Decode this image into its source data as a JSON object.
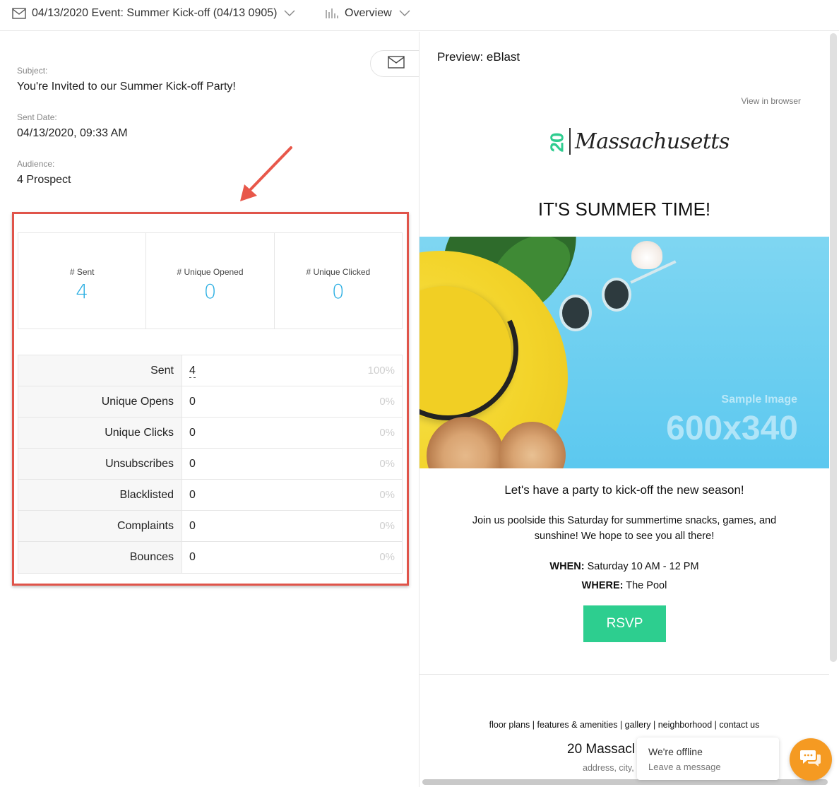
{
  "topbar": {
    "event_label": "04/13/2020 Event: Summer Kick-off (04/13 0905)",
    "view_label": "Overview"
  },
  "meta": {
    "subject_label": "Subject:",
    "subject_value": "You're Invited to our Summer Kick-off Party!",
    "sent_date_label": "Sent Date:",
    "sent_date_value": "04/13/2020, 09:33 AM",
    "audience_label": "Audience:",
    "audience_value": "4 Prospect"
  },
  "kpis": [
    {
      "label": "# Sent",
      "value": "4"
    },
    {
      "label": "# Unique Opened",
      "value": "0"
    },
    {
      "label": "# Unique Clicked",
      "value": "0"
    }
  ],
  "stats": [
    {
      "name": "Sent",
      "count": "4",
      "pct": "100%"
    },
    {
      "name": "Unique Opens",
      "count": "0",
      "pct": "0%"
    },
    {
      "name": "Unique Clicks",
      "count": "0",
      "pct": "0%"
    },
    {
      "name": "Unsubscribes",
      "count": "0",
      "pct": "0%"
    },
    {
      "name": "Blacklisted",
      "count": "0",
      "pct": "0%"
    },
    {
      "name": "Complaints",
      "count": "0",
      "pct": "0%"
    },
    {
      "name": "Bounces",
      "count": "0",
      "pct": "0%"
    }
  ],
  "preview": {
    "title": "Preview: eBlast",
    "view_in_browser": "View in browser",
    "logo_number": "20",
    "logo_name": "Massachusetts",
    "headline": "IT'S SUMMER TIME!",
    "hero_sample_label": "Sample Image",
    "hero_sample_size": "600x340",
    "subheadline": "Let's have a party to kick-off the new season!",
    "body": "Join us poolside this Saturday for summertime snacks, games, and sunshine! We hope to see you all there!",
    "when_label": "WHEN:",
    "when_value": "Saturday 10 AM - 12 PM",
    "where_label": "WHERE:",
    "where_value": "The Pool",
    "rsvp_label": "RSVP",
    "footer_links": [
      "floor plans",
      "features & amenities",
      "gallery",
      "neighborhood",
      "contact us"
    ],
    "footer_name": "20 Massacl",
    "footer_address": "address, city,"
  },
  "chat": {
    "title": "We're offline",
    "subtitle": "Leave a message"
  },
  "colors": {
    "accent_blue": "#29aee2",
    "highlight_red": "#e0544a",
    "rsvp_green": "#2dce8f",
    "chat_orange": "#f59a22"
  }
}
